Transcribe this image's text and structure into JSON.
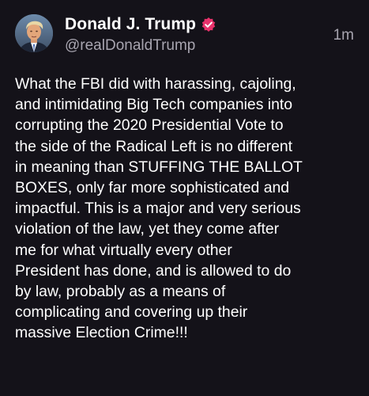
{
  "post": {
    "author": {
      "display_name": "Donald J. Trump",
      "handle": "@realDonaldTrump",
      "verified_icon": "verified-badge-icon",
      "verified_color": "#e8326b",
      "avatar": "profile-avatar"
    },
    "timestamp": "1m",
    "body": "What the FBI did with harassing, cajoling,\nand intimidating Big Tech companies into\ncorrupting the 2020 Presidential Vote to\nthe side of the Radical Left is no different\nin meaning than STUFFING THE BALLOT\nBOXES, only far more sophisticated and\nimpactful. This is a major and very serious\nviolation of the law, yet they come after\nme for what virtually every other\nPresident has done, and is allowed to do\nby law, probably as a means of\ncomplicating and covering up their\nmassive Election Crime!!!"
  },
  "colors": {
    "background": "#141219",
    "primary_text": "#ffffff",
    "secondary_text": "#a8a5b0"
  }
}
